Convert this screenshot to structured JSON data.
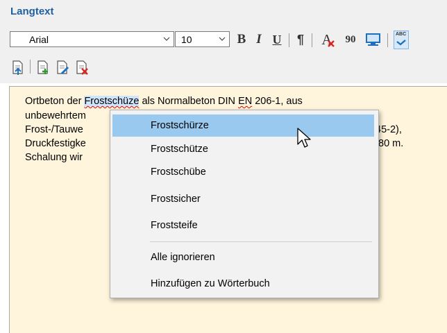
{
  "panel": {
    "title": "Langtext"
  },
  "toolbar": {
    "font_family": "Arial",
    "font_size": "10",
    "bold": "B",
    "italic": "I",
    "underline": "U",
    "pilcrow": "¶",
    "clear_format_letter": "A",
    "rotate_label": "90",
    "spell_check_label": "ABC",
    "icons": [
      "text-color-icon",
      "document-upload-icon",
      "document-add-icon",
      "document-edit-icon",
      "document-delete-icon",
      "monitor-icon",
      "spell-check-icon"
    ]
  },
  "editor": {
    "line1_pre": "Ortbeton der ",
    "line1_word": "Frostschüze",
    "line1_mid": " als Normalbeton DIN ",
    "line1_en": "EN",
    "line1_post": " 206-1, aus",
    "line2": "unbewehrtem",
    "line3": "Frost-/Tauwe",
    "line3_end": "45-2),",
    "line4": "Druckfestigke",
    "line4_end": "80 m.",
    "line5": "Schalung wir"
  },
  "context_menu": {
    "suggestions": [
      "Frostschürze",
      "Frostschütze",
      "Frostschübe",
      "Frostsicher",
      "Froststeife"
    ],
    "ignore_all": "Alle ignorieren",
    "add_to_dictionary": "Hinzufügen zu Wörterbuch"
  },
  "colors": {
    "accent_title": "#1f5f9e",
    "editor_bg": "#fff5dc",
    "menu_highlight": "#99c9ef",
    "toolbar_bg": "#f0f0f0"
  }
}
